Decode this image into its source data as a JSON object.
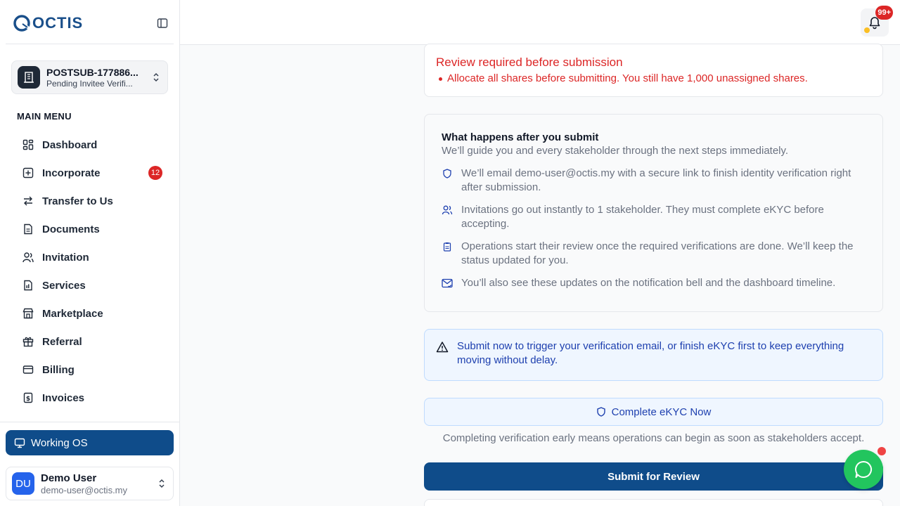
{
  "brand": {
    "logo_text": "OCTIS",
    "accent": "#0f4c8a",
    "danger": "#dc2626"
  },
  "company": {
    "name": "POSTSUB-177886...",
    "status": "Pending Invitee Verifi..."
  },
  "sidebar": {
    "menu_title": "MAIN MENU",
    "items": [
      {
        "label": "Dashboard",
        "icon": "dashboard-icon"
      },
      {
        "label": "Incorporate",
        "icon": "plus-square-icon",
        "badge": "12"
      },
      {
        "label": "Transfer to Us",
        "icon": "transfer-icon"
      },
      {
        "label": "Documents",
        "icon": "document-icon"
      },
      {
        "label": "Invitation",
        "icon": "users-icon"
      },
      {
        "label": "Services",
        "icon": "services-icon"
      },
      {
        "label": "Marketplace",
        "icon": "store-icon"
      },
      {
        "label": "Referral",
        "icon": "gift-icon"
      },
      {
        "label": "Billing",
        "icon": "card-icon"
      },
      {
        "label": "Invoices",
        "icon": "invoice-icon"
      }
    ],
    "working_os": "Working OS"
  },
  "user": {
    "initials": "DU",
    "name": "Demo User",
    "email": "demo-user@octis.my"
  },
  "header": {
    "notification_count": "99+"
  },
  "review_alert": {
    "title": "Review required before submission",
    "item": "Allocate all shares before submitting. You still have 1,000 unassigned shares."
  },
  "next_steps": {
    "title": "What happens after you submit",
    "subtitle": "We’ll guide you and every stakeholder through the next steps immediately.",
    "steps": [
      {
        "icon": "shield-icon",
        "text": "We’ll email demo-user@octis.my with a secure link to finish identity verification right after submission."
      },
      {
        "icon": "users-icon",
        "text": "Invitations go out instantly to 1 stakeholder. They must complete eKYC before accepting."
      },
      {
        "icon": "clipboard-icon",
        "text": "Operations start their review once the required verifications are done. We’ll keep the status updated for you."
      },
      {
        "icon": "mail-check-icon",
        "text": "You’ll also see these updates on the notification bell and the dashboard timeline."
      }
    ]
  },
  "notice": {
    "text": "Submit now to trigger your verification email, or finish eKYC first to keep everything moving without delay."
  },
  "ekyc": {
    "button_label": "Complete eKYC Now",
    "note": "Completing verification early means operations can begin as soon as stakeholders accept."
  },
  "submit": {
    "label": "Submit for Review"
  }
}
